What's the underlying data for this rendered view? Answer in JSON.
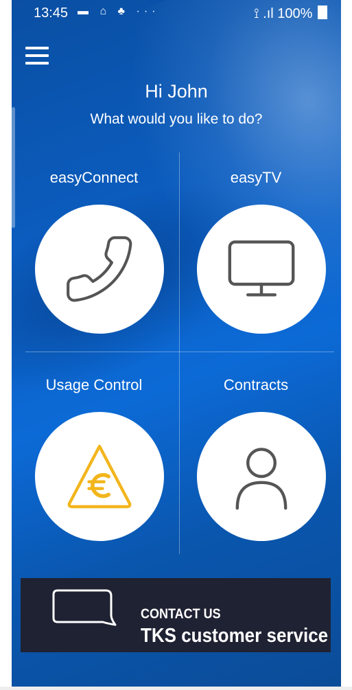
{
  "status_bar": {
    "time": "13:45",
    "notification_icons": "▬ ⌂ ♣ ···",
    "signal": "⟟ .ıl",
    "battery": "100%"
  },
  "header": {
    "greeting": "Hi John",
    "subtitle": "What would you like to do?"
  },
  "tiles": [
    {
      "label": "easyConnect",
      "icon": "phone-icon"
    },
    {
      "label": "easyTV",
      "icon": "tv-icon"
    },
    {
      "label": "Usage Control",
      "icon": "euro-warning-icon"
    },
    {
      "label": "Contracts",
      "icon": "person-icon"
    }
  ],
  "contact_banner": {
    "line1": "CONTACT US",
    "line2": "TKS customer service",
    "icon": "speech-bubble-icon"
  },
  "colors": {
    "background_blue": "#0b5ec2",
    "banner_dark": "#1f2232",
    "icon_gray": "#555555",
    "icon_yellow": "#f2b51c"
  }
}
